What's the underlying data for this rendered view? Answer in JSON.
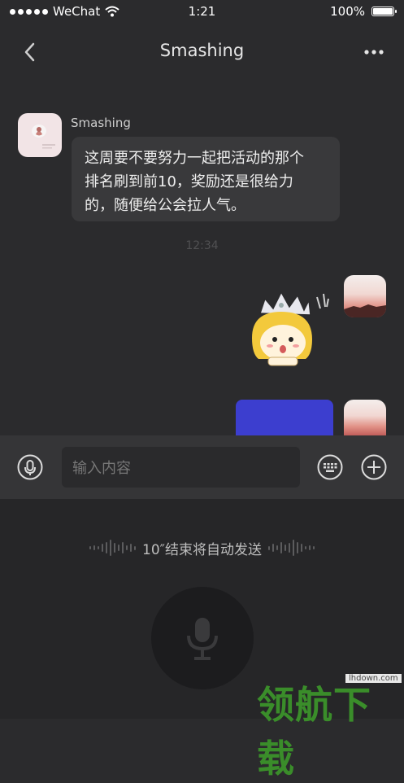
{
  "status_bar": {
    "carrier": "WeChat",
    "time": "1:21",
    "battery": "100%"
  },
  "nav": {
    "title": "Smashing",
    "back_icon": "chevron-left-icon",
    "more_icon": "more-horizontal-icon"
  },
  "messages": {
    "incoming": {
      "sender": "Smashing",
      "text_lines": [
        "这周要不要努力一起把活动的那个",
        "排名刷到前10，奖励还是很给力",
        "的，随便给公会拉人气。"
      ]
    },
    "timestamp": "12:34"
  },
  "input_bar": {
    "voice_icon": "microphone-icon",
    "placeholder": "输入内容",
    "keyboard_icon": "keyboard-icon",
    "add_icon": "plus-circle-icon"
  },
  "voice_panel": {
    "countdown": "10″结束将自动发送",
    "record_icon": "microphone-icon"
  },
  "watermark": {
    "site": "lhdown.com",
    "brand": "领航下载"
  }
}
